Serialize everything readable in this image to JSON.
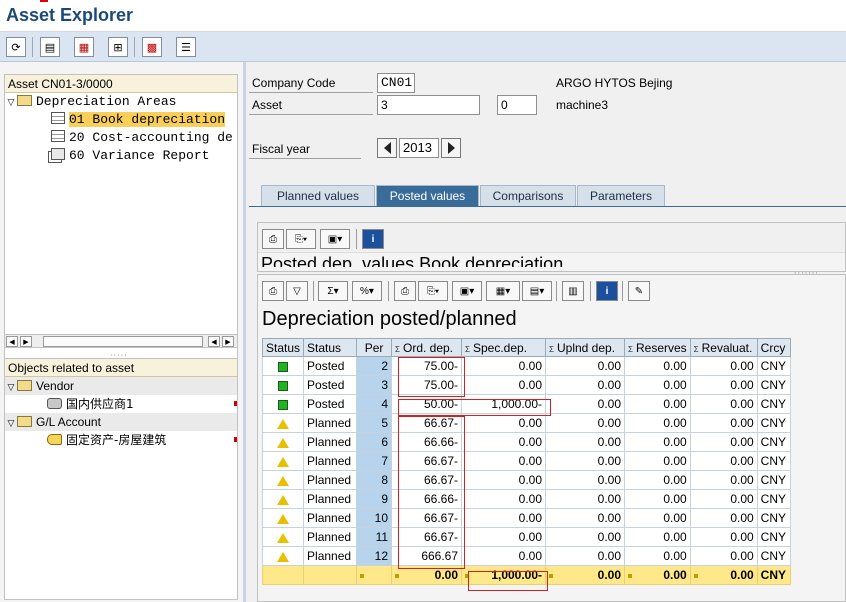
{
  "app": {
    "title": "Asset Explorer"
  },
  "toolbar": {
    "buttons": [
      "refresh-icon",
      "table-view-icon",
      "barcode-icon",
      "hierarchy-icon",
      "matrix-icon",
      "details-icon"
    ]
  },
  "tree1": {
    "header": "Asset CN01-3/0000",
    "root": "Depreciation Areas",
    "items": [
      {
        "label": "01 Book depreciation"
      },
      {
        "label": "20 Cost-accounting de"
      },
      {
        "label": "60 Variance Report"
      }
    ]
  },
  "tree2": {
    "header": "Objects related to asset",
    "vendor_group": "Vendor",
    "vendor_item": "国内供应商1",
    "gl_group": "G/L Account",
    "gl_item": "固定资产-房屋建筑"
  },
  "form": {
    "company_code_label": "Company Code",
    "company_code_value": "CN01",
    "company_name": "ARGO HYTOS Bejing",
    "asset_label": "Asset",
    "asset_value": "3",
    "asset_sub_value": "0",
    "asset_description": "machine3",
    "fiscal_year_label": "Fiscal year",
    "fiscal_year_value": "2013"
  },
  "tabs": [
    "Planned values",
    "Posted values",
    "Comparisons",
    "Parameters"
  ],
  "section1": {
    "title": "Posted dep. values Book depreciation"
  },
  "report": {
    "title": "Depreciation posted/planned",
    "columns": [
      "Status",
      "Status",
      "Per",
      "Ord. dep.",
      "Spec.dep.",
      "Uplnd dep.",
      "Reserves",
      "Revaluat.",
      "Crcy"
    ],
    "rows": [
      {
        "icon": "green",
        "status": "Posted",
        "per": "2",
        "ord": "75.00-",
        "spec": "0.00",
        "upl": "0.00",
        "res": "0.00",
        "rev": "0.00",
        "crcy": "CNY"
      },
      {
        "icon": "green",
        "status": "Posted",
        "per": "3",
        "ord": "75.00-",
        "spec": "0.00",
        "upl": "0.00",
        "res": "0.00",
        "rev": "0.00",
        "crcy": "CNY"
      },
      {
        "icon": "green",
        "status": "Posted",
        "per": "4",
        "ord": "50.00-",
        "spec": "1,000.00-",
        "upl": "0.00",
        "res": "0.00",
        "rev": "0.00",
        "crcy": "CNY"
      },
      {
        "icon": "yellow",
        "status": "Planned",
        "per": "5",
        "ord": "66.67-",
        "spec": "0.00",
        "upl": "0.00",
        "res": "0.00",
        "rev": "0.00",
        "crcy": "CNY"
      },
      {
        "icon": "yellow",
        "status": "Planned",
        "per": "6",
        "ord": "66.66-",
        "spec": "0.00",
        "upl": "0.00",
        "res": "0.00",
        "rev": "0.00",
        "crcy": "CNY"
      },
      {
        "icon": "yellow",
        "status": "Planned",
        "per": "7",
        "ord": "66.67-",
        "spec": "0.00",
        "upl": "0.00",
        "res": "0.00",
        "rev": "0.00",
        "crcy": "CNY"
      },
      {
        "icon": "yellow",
        "status": "Planned",
        "per": "8",
        "ord": "66.67-",
        "spec": "0.00",
        "upl": "0.00",
        "res": "0.00",
        "rev": "0.00",
        "crcy": "CNY"
      },
      {
        "icon": "yellow",
        "status": "Planned",
        "per": "9",
        "ord": "66.66-",
        "spec": "0.00",
        "upl": "0.00",
        "res": "0.00",
        "rev": "0.00",
        "crcy": "CNY"
      },
      {
        "icon": "yellow",
        "status": "Planned",
        "per": "10",
        "ord": "66.67-",
        "spec": "0.00",
        "upl": "0.00",
        "res": "0.00",
        "rev": "0.00",
        "crcy": "CNY"
      },
      {
        "icon": "yellow",
        "status": "Planned",
        "per": "11",
        "ord": "66.67-",
        "spec": "0.00",
        "upl": "0.00",
        "res": "0.00",
        "rev": "0.00",
        "crcy": "CNY"
      },
      {
        "icon": "yellow",
        "status": "Planned",
        "per": "12",
        "ord": "666.67",
        "spec": "0.00",
        "upl": "0.00",
        "res": "0.00",
        "rev": "0.00",
        "crcy": "CNY"
      }
    ],
    "totals": {
      "ord": "0.00",
      "spec": "1,000.00-",
      "upl": "0.00",
      "res": "0.00",
      "rev": "0.00",
      "crcy": "CNY"
    }
  },
  "colors": {
    "accent": "#3a6c9a",
    "selection": "#f9cf57",
    "total_row": "#ffe88a",
    "period_col": "#b7d4ec",
    "highlight_box": "#d32020"
  }
}
